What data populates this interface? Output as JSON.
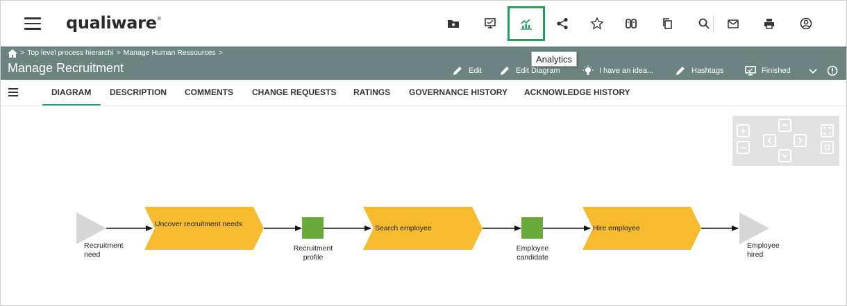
{
  "app": {
    "logo": "qualiware"
  },
  "toolbar": {
    "tooltip": "Analytics"
  },
  "breadcrumb": [
    "Top level process hierarchi",
    "Manage Human Ressources"
  ],
  "breadcrumb_sep": ">",
  "page_title": "Manage Recruitment",
  "header_actions": {
    "edit": "Edit",
    "edit_diagram": "Edit Diagram",
    "idea": "I have an idea...",
    "hashtags": "Hashtags",
    "finished": "Finished"
  },
  "tabs": [
    "DIAGRAM",
    "DESCRIPTION",
    "COMMENTS",
    "CHANGE REQUESTS",
    "RATINGS",
    "GOVERNANCE HISTORY",
    "ACKNOWLEDGE HISTORY"
  ],
  "diagram": {
    "start_event": [
      "Recruitment",
      "need"
    ],
    "activities": [
      "Uncover recruitment needs",
      "Search employee",
      "Hire employee"
    ],
    "objects": [
      [
        "Recruitment",
        "profile"
      ],
      [
        "Employee",
        "candidate"
      ]
    ],
    "end_event": [
      "Employee",
      "hired"
    ]
  },
  "colors": {
    "header": "#6b8381",
    "accent": "#1ea35a",
    "activity": "#f6bb2e",
    "object": "#6aaa3a",
    "event": "#d6d6d6"
  }
}
